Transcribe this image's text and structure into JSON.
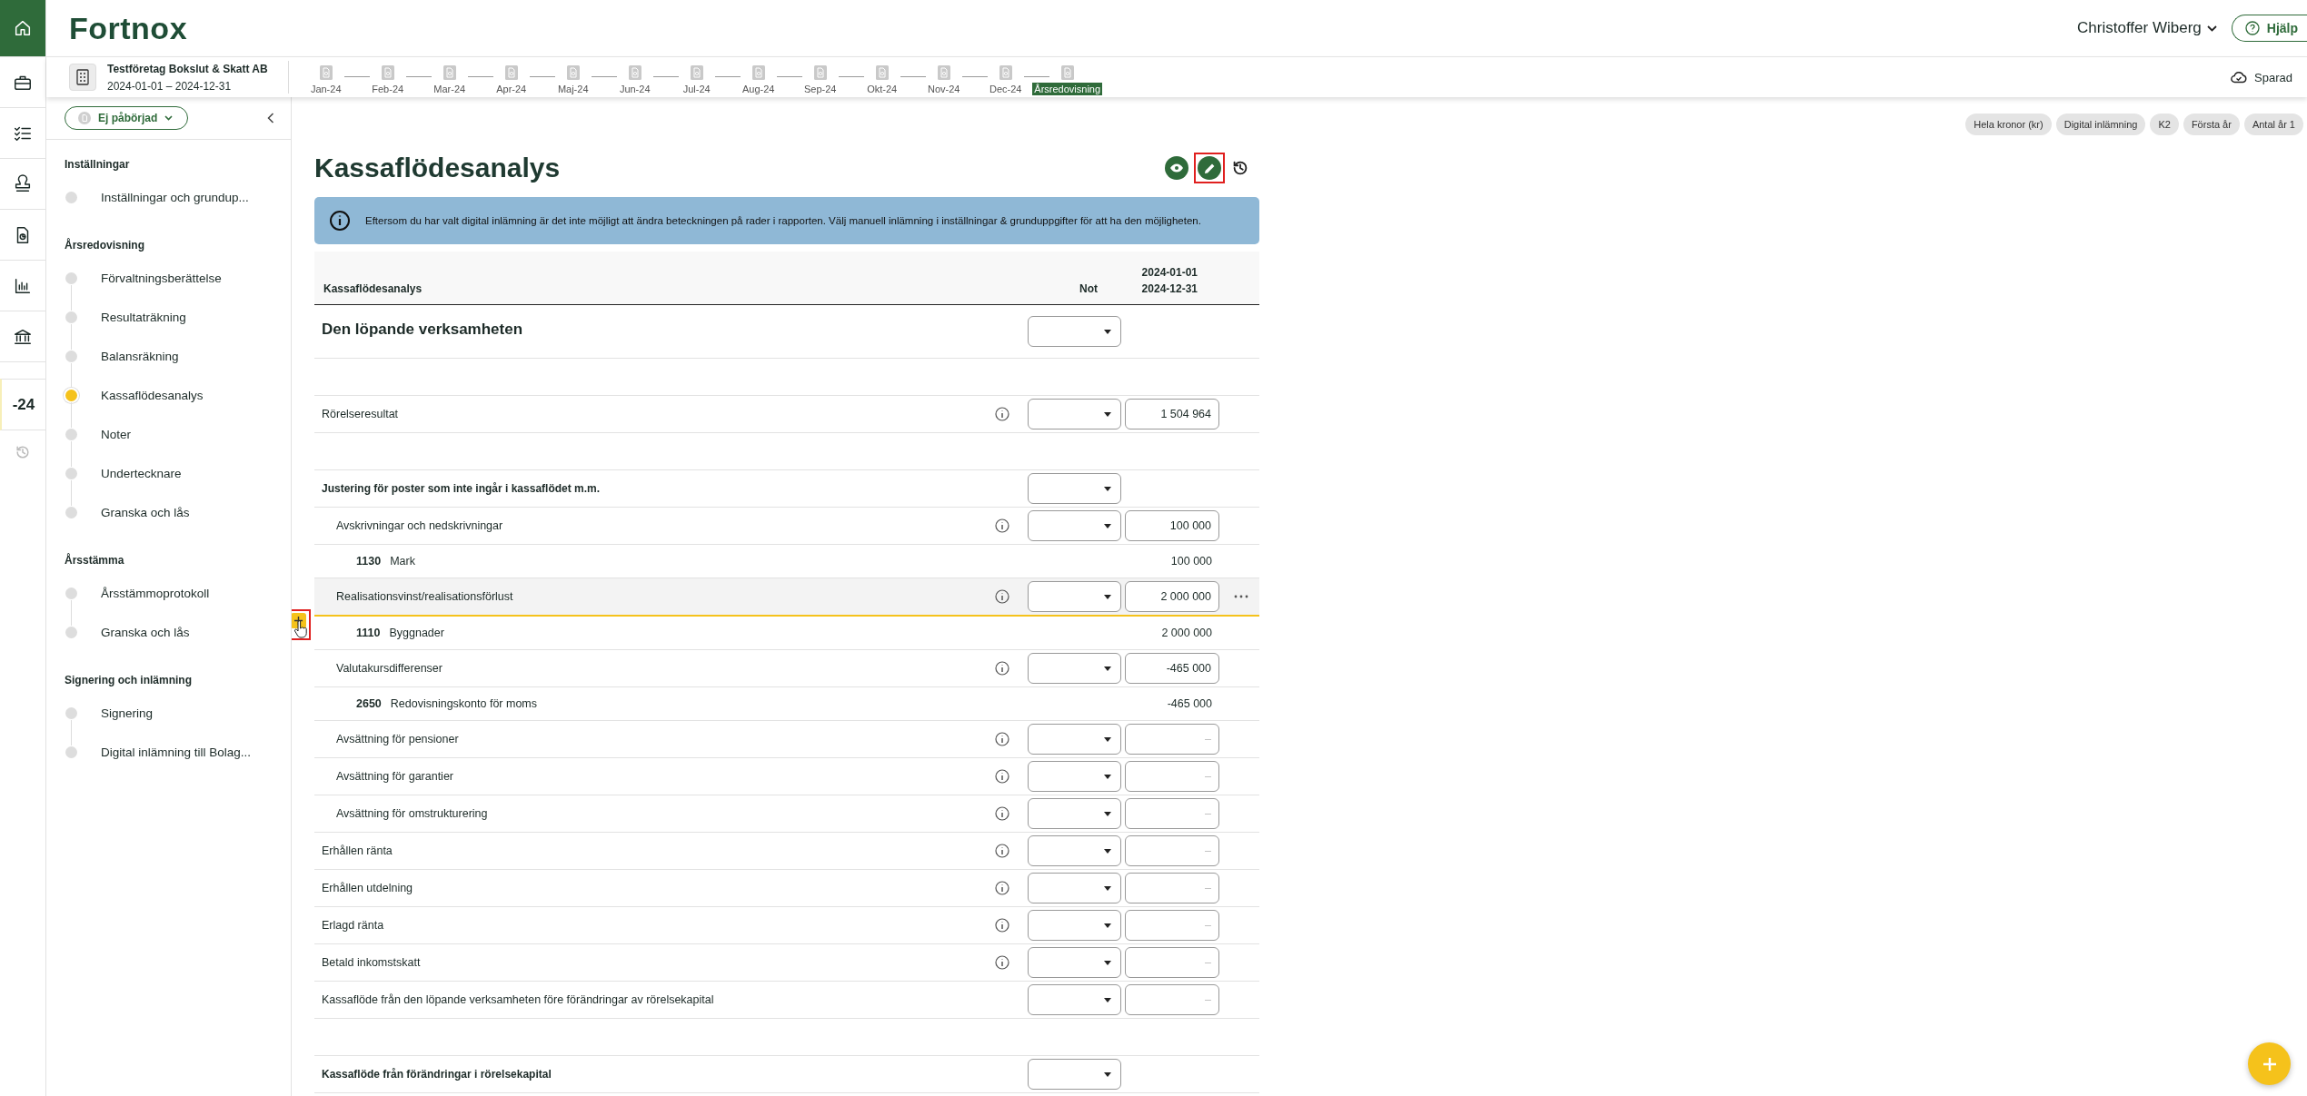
{
  "rail": {
    "items": [
      {
        "selected": true
      },
      {
        "selected": false
      },
      {
        "selected": false
      },
      {
        "selected": false
      },
      {
        "selected": false
      },
      {
        "selected": false
      },
      {
        "selected": false
      }
    ],
    "year_label": "-24"
  },
  "topbar": {
    "logo": "Fortnox",
    "user": "Christoffer Wiberg",
    "help": "Hjälp"
  },
  "subbar": {
    "company": "Testföretag Bokslut & Skatt AB",
    "period": "2024-01-01 – 2024-12-31",
    "save_status": "Sparad",
    "steps": [
      {
        "label": "Jan-24",
        "selected": false
      },
      {
        "label": "Feb-24",
        "selected": false
      },
      {
        "label": "Mar-24",
        "selected": false
      },
      {
        "label": "Apr-24",
        "selected": false
      },
      {
        "label": "Maj-24",
        "selected": false
      },
      {
        "label": "Jun-24",
        "selected": false
      },
      {
        "label": "Jul-24",
        "selected": false
      },
      {
        "label": "Aug-24",
        "selected": false
      },
      {
        "label": "Sep-24",
        "selected": false
      },
      {
        "label": "Okt-24",
        "selected": false
      },
      {
        "label": "Nov-24",
        "selected": false
      },
      {
        "label": "Dec-24",
        "selected": false
      },
      {
        "label": "Årsredovisning",
        "selected": true
      }
    ]
  },
  "sidebar": {
    "status": "Ej påbörjad",
    "sections": [
      {
        "title": "Inställningar",
        "items": [
          {
            "label": "Inställningar och grundup...",
            "selected": false
          }
        ]
      },
      {
        "title": "Årsredovisning",
        "items": [
          {
            "label": "Förvaltningsberättelse",
            "selected": false
          },
          {
            "label": "Resultaträkning",
            "selected": false
          },
          {
            "label": "Balansräkning",
            "selected": false
          },
          {
            "label": "Kassaflödesanalys",
            "selected": true
          },
          {
            "label": "Noter",
            "selected": false
          },
          {
            "label": "Undertecknare",
            "selected": false
          },
          {
            "label": "Granska och lås",
            "selected": false
          }
        ]
      },
      {
        "title": "Årsstämma",
        "items": [
          {
            "label": "Årsstämmoprotokoll",
            "selected": false
          },
          {
            "label": "Granska och lås",
            "selected": false
          }
        ]
      },
      {
        "title": "Signering och inlämning",
        "items": [
          {
            "label": "Signering",
            "selected": false
          },
          {
            "label": "Digital inlämning till Bolag...",
            "selected": false
          }
        ]
      }
    ]
  },
  "chips": [
    "Hela kronor (kr)",
    "Digital inlämning",
    "K2",
    "Första år",
    "Antal år 1"
  ],
  "title": "Kassaflödesanalys",
  "banner": "Eftersom du har valt digital inlämning är det inte möjligt att ändra beteckningen på rader i rapporten. Välj manuell inlämning i inställningar & grunduppgifter för att ha den möjligheten.",
  "table": {
    "header": {
      "label": "Kassaflödesanalys",
      "note": "Not",
      "period_start": "2024-01-01",
      "period_end": "2024-12-31"
    },
    "rows": [
      {
        "kind": "section",
        "label": "Den löpande verksamheten"
      },
      {
        "kind": "spacer"
      },
      {
        "kind": "line",
        "label": "Rörelseresultat",
        "info": true,
        "value": "1 504 964",
        "highlighted": false
      },
      {
        "kind": "spacer"
      },
      {
        "kind": "group",
        "label": "Justering för poster som inte ingår i kassaflödet m.m.",
        "children": [
          {
            "kind": "line",
            "label": "Avskrivningar och nedskrivningar",
            "info": true,
            "value": "100 000",
            "highlighted": false,
            "children": [
              {
                "kind": "account",
                "number": "1130",
                "label": "Mark",
                "value": "100 000"
              }
            ]
          },
          {
            "kind": "line",
            "label": "Realisationsvinst/realisationsförlust",
            "info": true,
            "value": "2 000 000",
            "highlighted": true,
            "children": [
              {
                "kind": "account",
                "number": "1110",
                "label": "Byggnader",
                "value": "2 000 000"
              }
            ]
          },
          {
            "kind": "line",
            "label": "Valutakursdifferenser",
            "info": true,
            "value": "-465 000",
            "highlighted": false,
            "children": [
              {
                "kind": "account",
                "number": "2650",
                "label": "Redovisningskonto för moms",
                "value": "-465 000"
              }
            ]
          },
          {
            "kind": "line",
            "label": "Avsättning för pensioner",
            "info": true,
            "placeholder": "–",
            "highlighted": false
          },
          {
            "kind": "line",
            "label": "Avsättning för garantier",
            "info": true,
            "placeholder": "–",
            "highlighted": false
          },
          {
            "kind": "line",
            "label": "Avsättning för omstrukturering",
            "info": true,
            "placeholder": "–",
            "highlighted": false
          }
        ]
      },
      {
        "kind": "line",
        "label": "Erhållen ränta",
        "info": true,
        "placeholder": "–",
        "highlighted": false
      },
      {
        "kind": "line",
        "label": "Erhållen utdelning",
        "info": true,
        "placeholder": "–",
        "highlighted": false
      },
      {
        "kind": "line",
        "label": "Erlagd ränta",
        "info": true,
        "placeholder": "–",
        "highlighted": false
      },
      {
        "kind": "line",
        "label": "Betald inkomstskatt",
        "info": true,
        "placeholder": "–",
        "highlighted": false
      },
      {
        "kind": "line",
        "label": "Kassaflöde från den löpande verksamheten före förändringar av rörelsekapital",
        "info": false,
        "placeholder": "–",
        "highlighted": false
      },
      {
        "kind": "spacer"
      },
      {
        "kind": "group",
        "label": "Kassaflöde från förändringar i rörelsekapital"
      }
    ]
  }
}
